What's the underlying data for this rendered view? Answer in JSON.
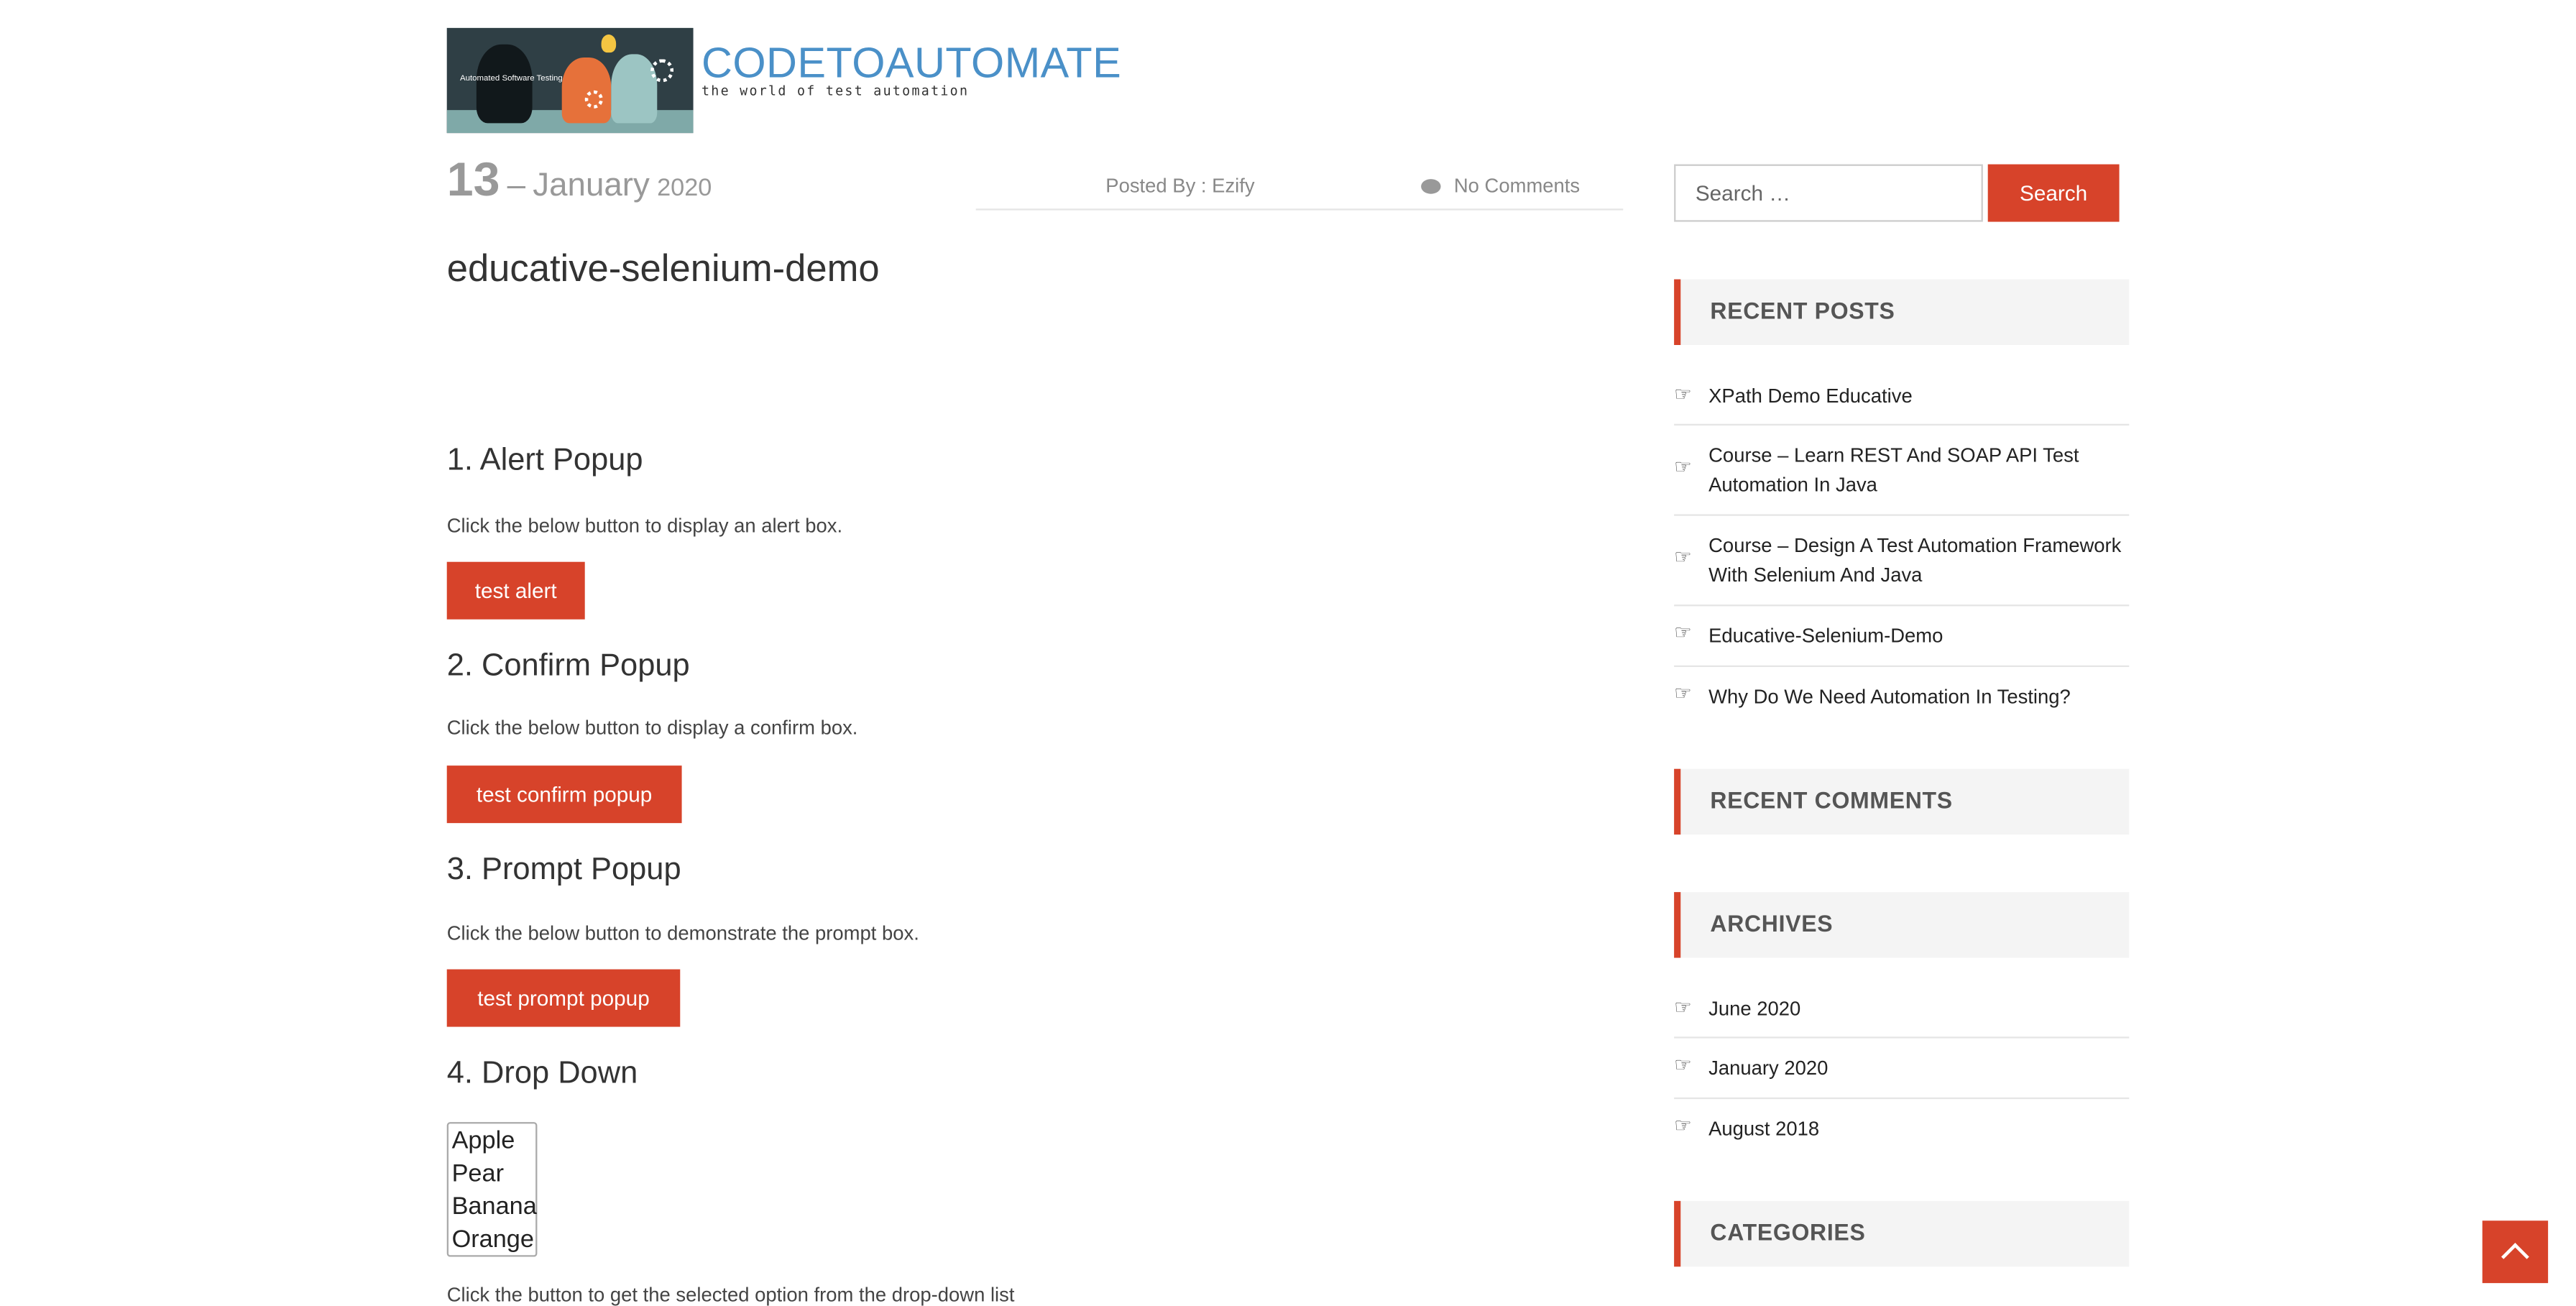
{
  "site": {
    "logo_tagline": "Automated Software Testing",
    "name": "CODETOAUTOMATE",
    "tagline": "the world of test automation"
  },
  "post": {
    "day": "13",
    "dash": "–",
    "month": "January",
    "year": "2020",
    "posted_by": "Posted By : Ezify",
    "comments": "No Comments",
    "title": "educative-selenium-demo"
  },
  "sections": [
    {
      "heading": "1. Alert Popup",
      "desc": "Click the below button to display an alert box.",
      "button": "test alert"
    },
    {
      "heading": "2. Confirm Popup",
      "desc": "Click the below button to display a confirm box.",
      "button": "test confirm popup"
    },
    {
      "heading": "3. Prompt Popup",
      "desc": "Click the below button to demonstrate the prompt box.",
      "button": "test prompt popup"
    },
    {
      "heading": "4. Drop Down",
      "options": [
        "Apple",
        "Pear",
        "Banana",
        "Orange"
      ],
      "desc_partial": "Click the button to get the selected option from the drop-down list"
    }
  ],
  "sidebar": {
    "search_placeholder": "Search …",
    "search_button": "Search",
    "recent_posts_title": "RECENT POSTS",
    "recent_posts": [
      "XPath Demo Educative",
      "Course – Learn REST And SOAP API Test Automation In Java",
      "Course – Design A Test Automation Framework With Selenium And Java",
      "Educative-Selenium-Demo",
      "Why Do We Need Automation In Testing?"
    ],
    "recent_comments_title": "RECENT COMMENTS",
    "archives_title": "ARCHIVES",
    "archives": [
      "June 2020",
      "January 2020",
      "August 2018"
    ],
    "categories_title": "CATEGORIES"
  },
  "icons": {
    "comment": "comment-icon",
    "list_bullet": "hand-pointer-icon",
    "back_to_top": "chevron-up-icon"
  },
  "colors": {
    "accent": "#d7432a",
    "brand": "#4a90c8"
  }
}
